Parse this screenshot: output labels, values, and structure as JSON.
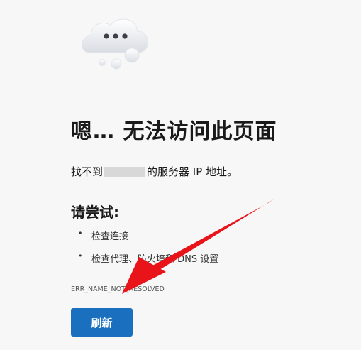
{
  "error_page": {
    "icon": "cloud-with-dots-icon",
    "title": "嗯… 无法访问此页面",
    "message_before": "找不到",
    "message_after": "的服务器 IP 地址。",
    "suggestion_heading": "请尝试:",
    "suggestions": [
      "检查连接",
      "检查代理、防火墙和 DNS 设置"
    ],
    "error_code": "ERR_NAME_NOT_RESOLVED",
    "refresh_label": "刷新"
  },
  "annotation": {
    "icon": "red-arrow-icon",
    "color": "#e8141a"
  },
  "colors": {
    "accent": "#1a6fbf",
    "background": "#f7f7f7"
  }
}
